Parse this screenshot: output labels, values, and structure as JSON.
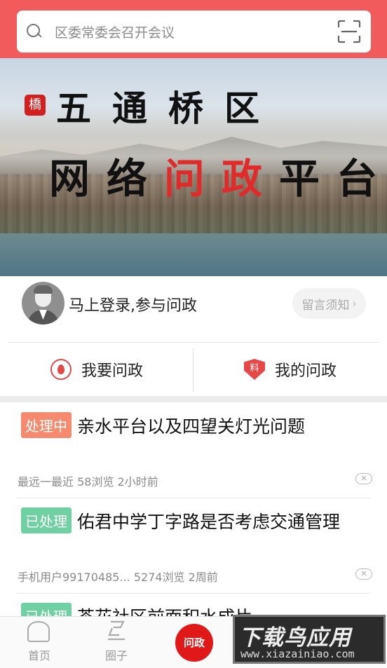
{
  "search": {
    "placeholder": "区委常委会召开会议"
  },
  "banner": {
    "seal_text": "橋",
    "line1": "五通桥区",
    "line2_part1": "网络",
    "line2_red": "问政",
    "line2_part2": "平台"
  },
  "user": {
    "login_prompt": "马上登录,参与问政",
    "notice_label": "留言须知",
    "notice_chevron": "›"
  },
  "actions": {
    "ask_label": "我要问政",
    "mine_label": "我的问政",
    "shield_glyph": "料"
  },
  "feed": {
    "items": [
      {
        "status": "处理中",
        "title": "亲水平台以及四望关灯光问题",
        "meta": "最远一最近  58浏览  2小时前"
      },
      {
        "status": "已处理",
        "title": "佑君中学丁字路是否考虑交通管理",
        "meta": "手机用户99170485...  5274浏览  2周前"
      },
      {
        "status": "已处理",
        "title": "茶花社区前面积水成片"
      }
    ],
    "close_glyph": "✕"
  },
  "tabbar": {
    "home": "首页",
    "circle": "圈子",
    "center": "问政"
  },
  "watermark": {
    "title": "下载鸟应用",
    "url": "www.xiazainiao.com"
  },
  "colors": {
    "primary": "#f15b5b",
    "processing": "#f58a6f",
    "done": "#6fd1a3",
    "center": "#e01818"
  }
}
